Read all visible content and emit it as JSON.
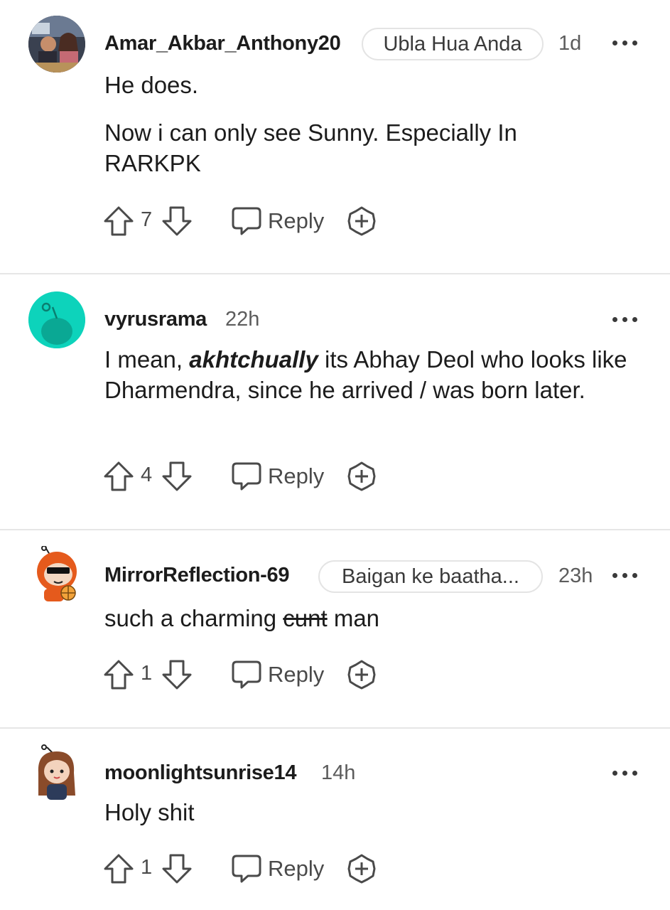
{
  "comments": [
    {
      "username": "Amar_Akbar_Anthony20",
      "flair": "Ubla Hua Anda",
      "time": "1d",
      "body": [
        "He does.",
        "Now i can only see Sunny. Especially In RARKPK"
      ],
      "votes": "7",
      "reply_label": "Reply",
      "avatar": "photo-avatar"
    },
    {
      "username": "vyrusrama",
      "time": "22h",
      "body_parts": [
        "I mean, ",
        "akhtchually",
        " its Abhay Deol who looks like Dharmendra, since he arrived / was born later."
      ],
      "votes": "4",
      "reply_label": "Reply",
      "avatar": "snoo-default-avatar"
    },
    {
      "username": "MirrorReflection-69",
      "flair": "Baigan ke baatha...",
      "time": "23h",
      "body_parts": [
        "such a charming ",
        "cunt",
        " man"
      ],
      "votes": "1",
      "reply_label": "Reply",
      "avatar": "snoo-sunglasses-avatar"
    },
    {
      "username": "moonlightsunrise14",
      "time": "14h",
      "body": [
        "Holy shit"
      ],
      "votes": "1",
      "reply_label": "Reply",
      "avatar": "snoo-girl-avatar"
    }
  ],
  "colors": {
    "teal_avatar": "#0dd3bb",
    "text": "#1c1c1c",
    "meta": "#5c5c5c",
    "icon": "#4a4a4a",
    "divider": "#e6e6e6"
  }
}
